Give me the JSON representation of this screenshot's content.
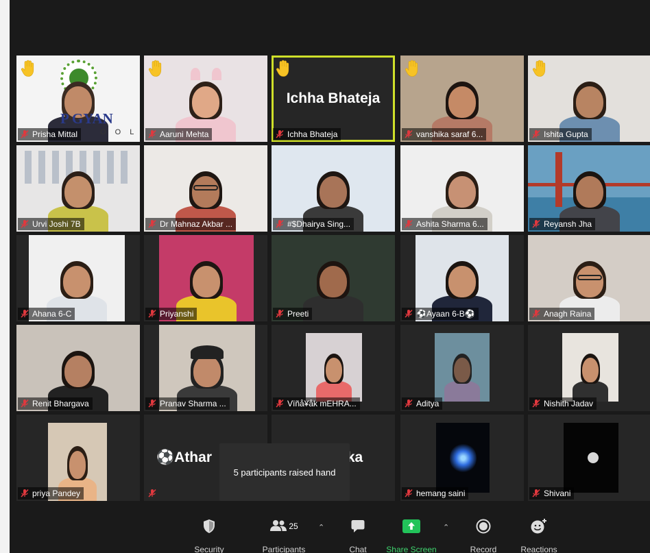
{
  "meeting": {
    "raised_hand_tooltip": "5 participants raised hand",
    "participants_count": "25"
  },
  "tiles": [
    {
      "name": "Prisha Mittal",
      "hand": true
    },
    {
      "name": "Aaruni Mehta",
      "hand": true
    },
    {
      "name": "Ichha Bhateja",
      "hand": true,
      "big_label": "Ichha Bhateja"
    },
    {
      "name": "vanshika saraf 6...",
      "hand": true
    },
    {
      "name": "Ishita Gupta",
      "hand": true
    },
    {
      "name": "Urvi Joshi 7B"
    },
    {
      "name": "Dr Mahnaz Akbar ..."
    },
    {
      "name": "#$Dhairya Sing..."
    },
    {
      "name": "Ashita Sharma 6..."
    },
    {
      "name": "Reyansh Jha"
    },
    {
      "name": "Ahana 6-C"
    },
    {
      "name": "Priyanshi"
    },
    {
      "name": "Preeti"
    },
    {
      "name": "⚽Ayaan 6-B⚽"
    },
    {
      "name": "Anagh Raina"
    },
    {
      "name": "Renit Bhargava"
    },
    {
      "name": "Pranav Sharma ..."
    },
    {
      "name": "Vïñå¥åk mEHRA..."
    },
    {
      "name": "Aditya"
    },
    {
      "name": "Nishith Jadav"
    },
    {
      "name": "priya Pandey"
    },
    {
      "name": "",
      "big_label": "⚽Athar"
    },
    {
      "name": "",
      "big_label": "ika"
    },
    {
      "name": "hemang saini"
    },
    {
      "name": "Shivani"
    }
  ],
  "logo": {
    "line1": "P GYAN",
    "line2": "O O L"
  },
  "toolbar": {
    "security": "Security",
    "participants": "Participants",
    "chat": "Chat",
    "share_screen": "Share Screen",
    "record": "Record",
    "reactions": "Reactions"
  },
  "colors": {
    "active_speaker": "#cfe02a",
    "share_green": "#22c35a",
    "hand_yellow": "#f7c325",
    "mic_muted_red": "#e0383e"
  }
}
